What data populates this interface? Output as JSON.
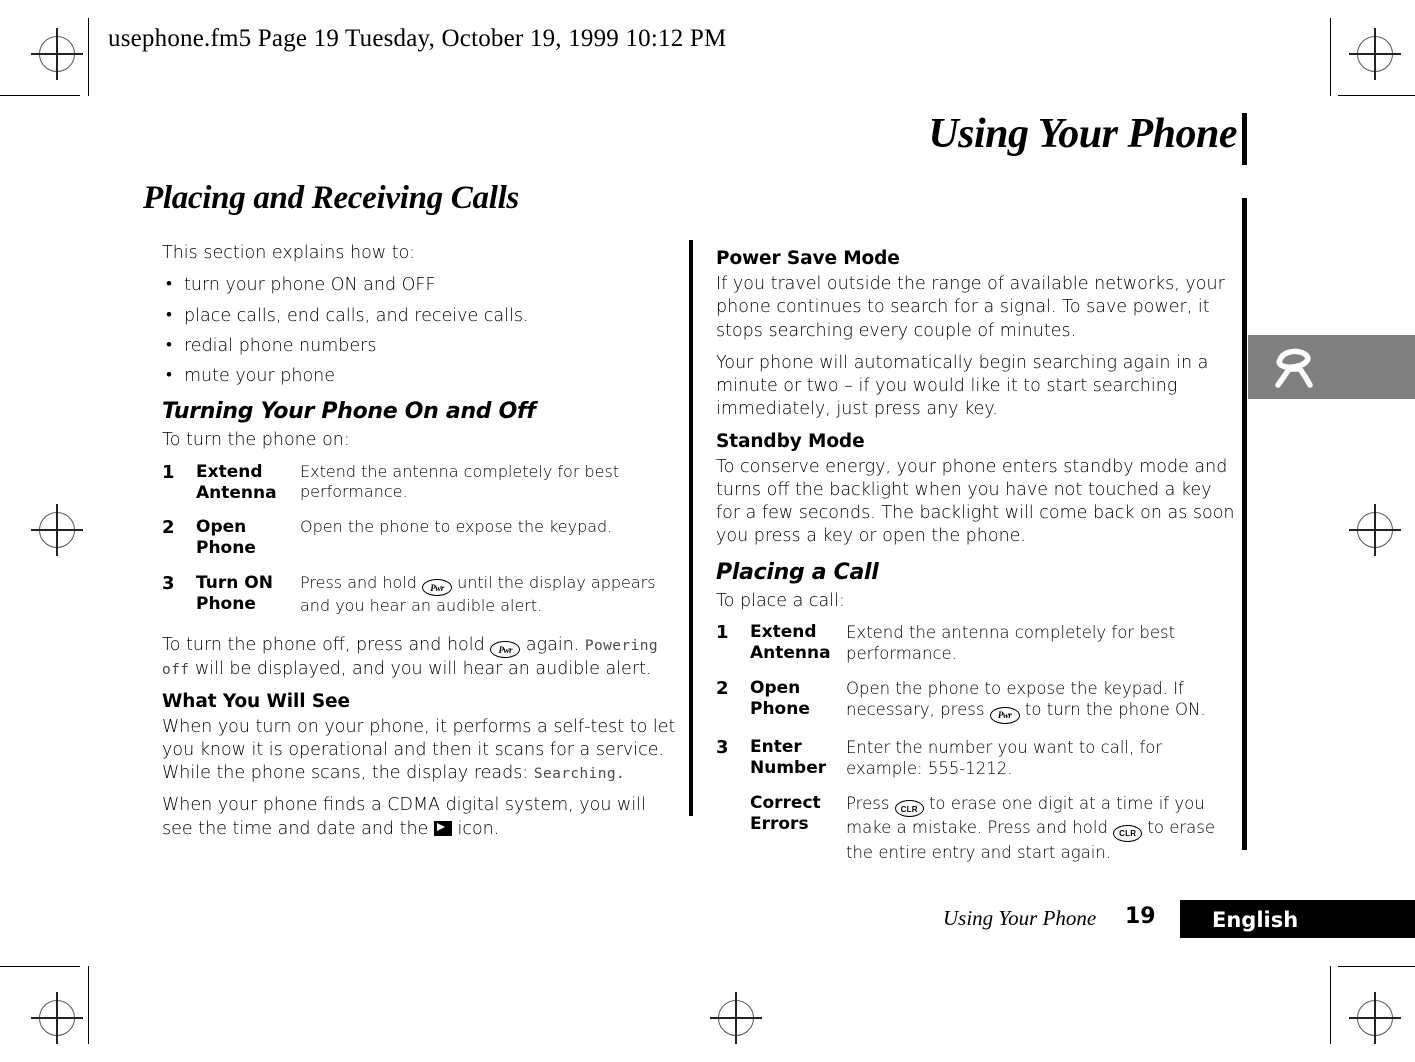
{
  "print": {
    "running_head": "usephone.fm5  Page 19  Tuesday, October 19, 1999  10:12 PM"
  },
  "chapter": {
    "title": "Using Your Phone",
    "section_title": "Placing and Receiving Calls"
  },
  "side_tab": {
    "icon": "phone-handset-icon",
    "color": "#808080"
  },
  "left_column": {
    "intro": "This section explains how to:",
    "bullets": [
      "turn your phone ON and OFF",
      "place calls, end calls, and receive calls.",
      "redial phone numbers",
      "mute your phone"
    ],
    "heading_turning": "Turning Your Phone On and Off",
    "lead_turn_on": "To turn the phone on:",
    "steps": [
      {
        "num": "1",
        "label": "Extend Antenna",
        "desc": "Extend the antenna completely for best performance."
      },
      {
        "num": "2",
        "label": "Open Phone",
        "desc": "Open the phone to expose the keypad."
      },
      {
        "num": "3",
        "label": "Turn ON Phone",
        "desc_before": "Press and hold",
        "key": "Pwr",
        "desc_after": "until the display appears and you hear an audible alert."
      }
    ],
    "turn_off": {
      "before": "To turn the phone off, press and hold",
      "key": "Pwr",
      "middle": "again.",
      "display_text": "Powering off",
      "after": "will be displayed, and you will hear an audible alert."
    },
    "heading_what_you_will_see": "What You Will See",
    "para_self_test_before": "When you turn on your phone, it performs a self-test to let you know it is operational and then it scans for a service. While the phone scans, the display reads:",
    "para_self_test_display": "Searching.",
    "para_cdma_before": "When your phone finds a CDMA digital system, you will see the time and date and the",
    "para_cdma_icon": "cdma-digital-icon",
    "para_cdma_after": "icon."
  },
  "right_column": {
    "heading_power_save": "Power Save Mode",
    "para_power_save_1": "If you travel outside the range of available networks, your phone continues to search for a signal. To save power, it stops searching every couple of minutes.",
    "para_power_save_2": "Your phone will automatically begin searching again in a minute or two – if you would like it to start searching immediately, just press any key.",
    "heading_standby": "Standby Mode",
    "para_standby": "To conserve energy, your phone enters standby mode and turns off the backlight when you have not touched a key for a few seconds. The backlight will come back on as soon you press a key or open the phone.",
    "heading_placing_call": "Placing a Call",
    "lead_place_call": "To place a call:",
    "steps": [
      {
        "num": "1",
        "label": "Extend Antenna",
        "desc": "Extend the antenna completely for best performance."
      },
      {
        "num": "2",
        "label": "Open Phone",
        "desc_before": "Open the phone to expose the keypad. If necessary, press",
        "key": "Pwr",
        "desc_after": "to turn the phone ON."
      },
      {
        "num": "3",
        "label": "Enter Number",
        "desc": "Enter the number you want to call, for example: 555-1212."
      },
      {
        "num": "",
        "label": "Correct Errors",
        "desc_before": "Press",
        "key": "CLR",
        "desc_middle": "to erase one digit at a time if you make a mistake. Press and hold",
        "key2": "CLR",
        "desc_after": "to erase the entire entry and start again."
      }
    ]
  },
  "footer": {
    "title": "Using Your Phone",
    "page_number": "19",
    "language": "English"
  }
}
